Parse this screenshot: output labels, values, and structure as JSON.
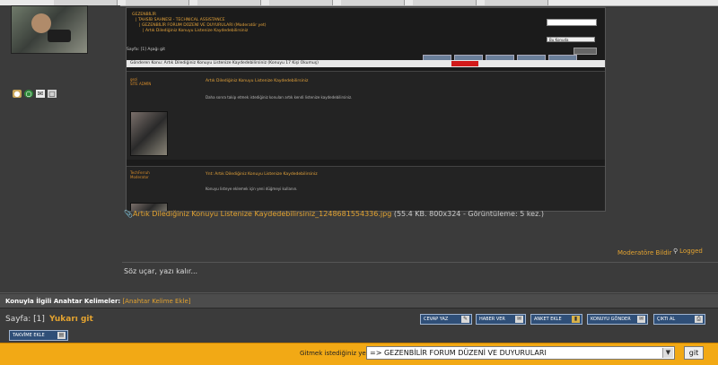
{
  "embedded": {
    "nav": [
      "GEZENBİLİR",
      "| TAHSİB SAHNESİ - TECHNICAL ASSISTANCE",
      "| GEZENBİLİR FORUM DÜZENİ VE DUYURULARI (Moderatör yet)",
      "| Artık Dilediğiniz Konuyu Listenize Kaydedebilirsiniz"
    ],
    "search_select": "Bu Konuda",
    "pager": "Sayfa: [1]   Aşağı git",
    "thread_bar": "Gönderen        Konu: Artık Dilediğiniz Konuyu Listenize Kaydedebilirsiniz  (Konuyu 17 Kişi Okumuş)",
    "post1_name": "gezi\nSİTE ADMİN",
    "post1_title": "Artık Dilediğiniz Konuyu Listenize Kaydedebilirsiniz",
    "post1_text": "Daha sonra takip etmek istediğiniz konuları artık kendi listenize kaydedebilirsiniz.",
    "post2_name": "TechFerruh\nModerator",
    "post2_title": "Ynt: Artık Dilediğiniz Konuyu Listenize Kaydedebilirsiniz",
    "post2_text": "Konuyu listeye eklemek için yeni düğmeyi kullanın."
  },
  "caption": {
    "file": "Artık Dilediğiniz Konuyu Listenize Kaydedebilirsiniz_1248681554336.jpg",
    "meta": "(55.4 KB. 800x324 - Görüntüleme: 5 kez.)"
  },
  "post_links": {
    "moderator": "Moderatöre Bildir",
    "logged": "Logged"
  },
  "signature": "Söz uçar, yazı kalır...",
  "keywords": {
    "label": "Konuyla İlgili Anahtar Kelimeler:",
    "add": "[Anahtar Kelime Ekle]"
  },
  "pagination": {
    "page": "Sayfa: [1]",
    "go_up": "Yukarı git"
  },
  "actions": [
    {
      "label": "CEVAP YAZ",
      "icon": "reply-icon"
    },
    {
      "label": "HABER VER",
      "icon": "notify-icon"
    },
    {
      "label": "ANKET EKLE",
      "icon": "poll-icon"
    },
    {
      "label": "KONUYU GÖNDER",
      "icon": "send-icon"
    },
    {
      "label": "ÇIKTI AL",
      "icon": "print-icon"
    }
  ],
  "watch_button": "TAKVİME EKLE",
  "jump": {
    "label": "Gitmek istediğiniz yer:",
    "selected": "=> GEZENBİLİR FORUM DÜZENİ VE DUYURULARI",
    "go": "git"
  },
  "colors": {
    "accent": "#e3a330",
    "jump_bar": "#f2a915",
    "button": "#2f4f78"
  }
}
